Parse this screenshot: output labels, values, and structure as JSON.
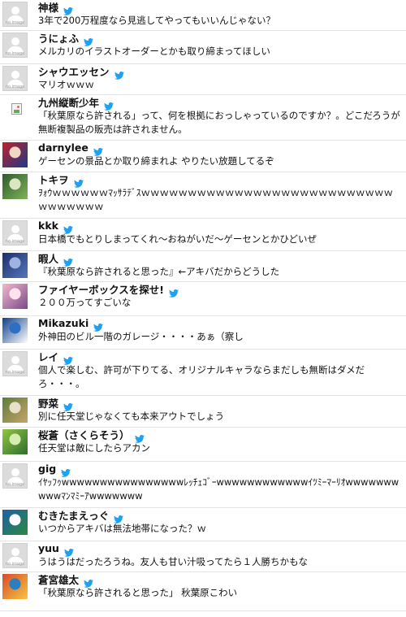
{
  "colors": {
    "twitter_blue": "#1da1f2",
    "divider": "#e3e3e3",
    "noimage_bg": "#dcdcdc"
  },
  "placeholder_text": "no image",
  "icons": {
    "tweet_source": "twitter-bird-icon",
    "default_avatar": "no-image-icon",
    "broken_avatar": "broken-image-icon"
  },
  "tweets": [
    {
      "username": "神様",
      "text": "3年で200万程度なら見逃してやってもいいんじゃない？",
      "avatar": {
        "type": "noimage"
      }
    },
    {
      "username": "うにょふ",
      "text": "メルカリのイラストオーダーとかも取り締まってほしい",
      "avatar": {
        "type": "noimage"
      }
    },
    {
      "username": "シャウエッセン",
      "text": "マリオｗｗｗ",
      "avatar": {
        "type": "noimage"
      }
    },
    {
      "username": "九州縦断少年",
      "text": "「秋葉原なら許される」って、何を根拠におっしゃっているのですか？。どこだろうが無断複製品の販売は許されません。",
      "avatar": {
        "type": "broken"
      }
    },
    {
      "username": "darnylee",
      "text": "ゲーセンの景品とか取り締まれよ やりたい放題してるぞ",
      "avatar": {
        "type": "image",
        "colors": [
          "#c0202a",
          "#1a3a8a",
          "#f2d7c4"
        ]
      }
    },
    {
      "username": "トキヲ",
      "text": "ｦｫｳｗｗｗｗｗｗﾏｯｻﾗﾃﾞｽｗｗｗｗｗｗｗｗｗｗｗｗｗｗｗｗｗｗｗｗｗｗｗｗｗｗｗｗｗｗｗｗｗｗ",
      "avatar": {
        "type": "image",
        "colors": [
          "#2e5a2a",
          "#7fb35a",
          "#d9e8c0"
        ]
      }
    },
    {
      "username": "kkk",
      "text": "日本橋でもとりしまってくれ〜おねがいだ〜ゲーセンとかひどいぜ",
      "avatar": {
        "type": "noimage"
      }
    },
    {
      "username": "暇人",
      "text": "『秋葉原なら許されると思った』←アキバだからどうした",
      "avatar": {
        "type": "image",
        "colors": [
          "#1c2f6b",
          "#5577bb",
          "#9fb3e0"
        ]
      }
    },
    {
      "username": "ファイヤーボックスを探せ!",
      "text": "２００万ってすごいな",
      "avatar": {
        "type": "image",
        "colors": [
          "#f4b8cc",
          "#7a4a8a",
          "#ffe3ec"
        ]
      }
    },
    {
      "username": "Mikazuki",
      "text": "外神田のビル一階のガレージ・・・・あぁ（察し",
      "avatar": {
        "type": "image",
        "colors": [
          "#0d3f8c",
          "#ffffff",
          "#2f6fc2"
        ]
      }
    },
    {
      "username": "レイ",
      "text": "個人で楽しむ、許可が下りてる、オリジナルキャラならまだしも無断はダメだろ・・・。",
      "avatar": {
        "type": "noimage"
      }
    },
    {
      "username": "野菜",
      "text": "別に任天堂じゃなくても本来アウトでしょう",
      "avatar": {
        "type": "image",
        "colors": [
          "#5a7d3a",
          "#c9a36b",
          "#e8e0c8"
        ]
      }
    },
    {
      "username": "桜蒼（さくらそう）",
      "text": "任天堂は敵にしたらアカン",
      "avatar": {
        "type": "image",
        "colors": [
          "#8fc63f",
          "#2f6e2f",
          "#d7ecb0"
        ]
      }
    },
    {
      "username": "gig",
      "text": "ｲﾔｯﾌｩwwwwwwwwwwwwwwwwﾚｯﾁｪｺﾞｰwwwwwwwwwwwwｲﾂﾐｰﾏｰﾘｵwwwwwwwwwwﾏﾝﾏﾐｰｱwwwwwww",
      "avatar": {
        "type": "noimage"
      }
    },
    {
      "username": "むきたまえっぐ",
      "text": "いつからアキバは無法地帯になった？ｗ",
      "avatar": {
        "type": "image",
        "colors": [
          "#1f5fa8",
          "#2b8a3e",
          "#ffffff"
        ]
      }
    },
    {
      "username": "yuu",
      "text": "うはうはだったろうね。友人も甘い汁吸ってたら１人勝ちかもな",
      "avatar": {
        "type": "noimage"
      }
    },
    {
      "username": "蒼宮雄太",
      "text": "「秋葉原なら許されると思った」 秋葉原こわい",
      "avatar": {
        "type": "image",
        "colors": [
          "#d94a2a",
          "#f4c542",
          "#2a7fc1"
        ]
      }
    }
  ]
}
